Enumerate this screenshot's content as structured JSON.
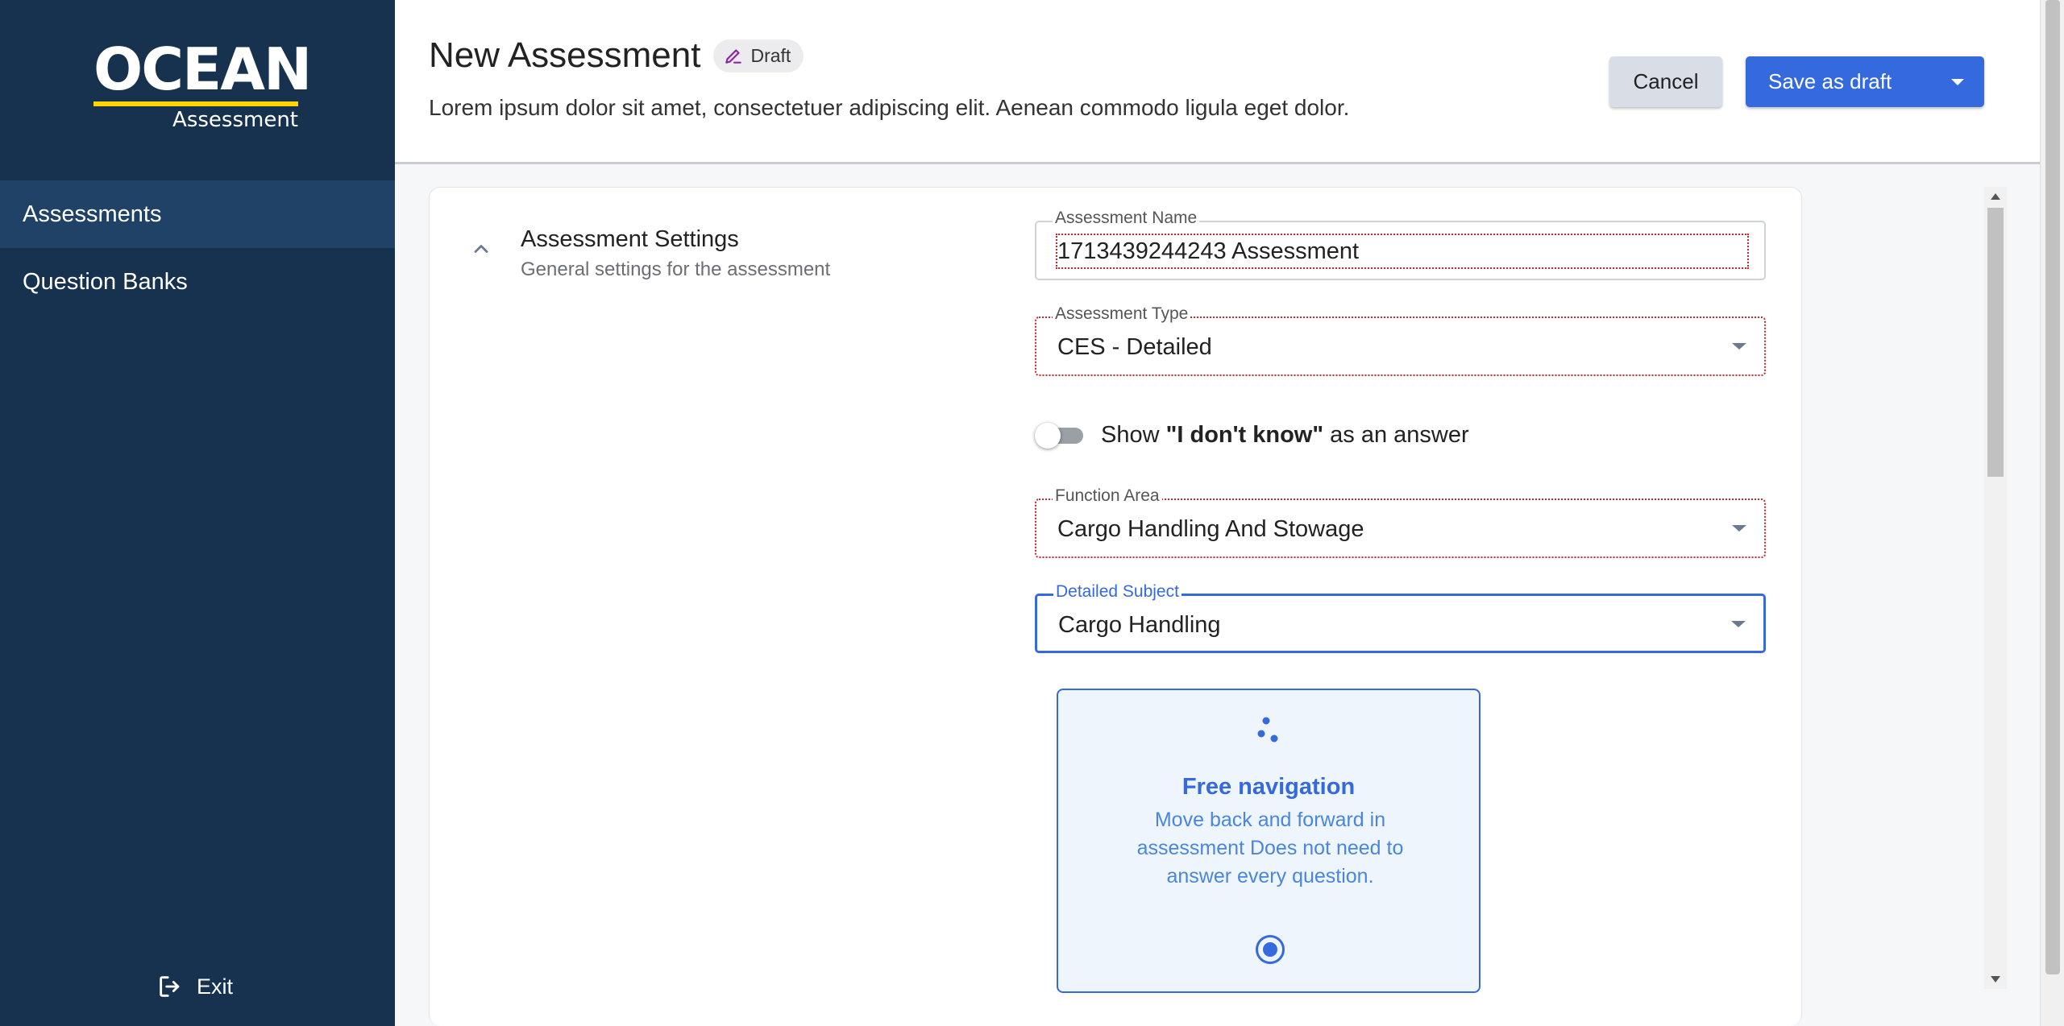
{
  "brand": {
    "name": "OCEAN",
    "sub": "Assessment",
    "accent": "#ffd400"
  },
  "sidebar": {
    "items": [
      {
        "label": "Assessments",
        "active": true
      },
      {
        "label": "Question Banks",
        "active": false
      }
    ],
    "exit_label": "Exit"
  },
  "header": {
    "title": "New Assessment",
    "badge": "Draft",
    "subtitle": "Lorem ipsum dolor sit amet, consectetuer adipiscing elit. Aenean commodo ligula eget dolor.",
    "cancel_label": "Cancel",
    "save_label": "Save as draft"
  },
  "section": {
    "title": "Assessment Settings",
    "description": "General settings for the assessment"
  },
  "form": {
    "assessment_name": {
      "label": "Assessment Name",
      "value": "1713439244243 Assessment"
    },
    "assessment_type": {
      "label": "Assessment Type",
      "value": "CES - Detailed"
    },
    "toggle": {
      "prefix": "Show ",
      "emphasis": "\"I don't know\"",
      "suffix": " as an answer",
      "on": false
    },
    "function_area": {
      "label": "Function Area",
      "value": "Cargo Handling And Stowage"
    },
    "detailed_subject": {
      "label": "Detailed Subject",
      "value": "Cargo Handling"
    }
  },
  "navigation_option": {
    "title": "Free navigation",
    "description": "Move back and forward in assessment Does not need to answer every question.",
    "selected": true
  },
  "colors": {
    "sidebar": "#16324f",
    "primary": "#3569de",
    "error": "#d2202c"
  }
}
